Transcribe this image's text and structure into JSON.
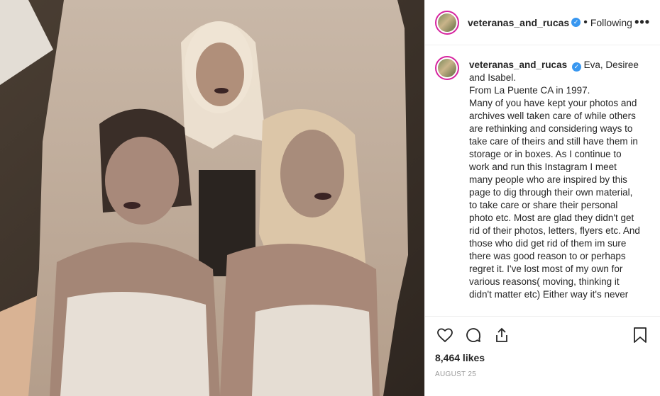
{
  "post": {
    "username": "veteranas_and_rucas",
    "follow_label": "Following",
    "separator": "•",
    "more_label": "•••",
    "verified_glyph": "✓"
  },
  "caption": {
    "username": "veteranas_and_rucas",
    "text": "Eva, Desiree\nand Isabel.\nFrom La Puente CA in 1997.\nMany of you have kept your photos and archives well taken care of while others are rethinking and considering ways to take care of theirs and still have them in storage or in boxes. As I continue to work and run this Instagram I meet many people who are inspired by this page to dig through their own material, to take care or share their personal photo etc. Most are glad they didn't get rid of their photos, letters, flyers etc. And those who did get rid of them im sure there was good reason to or perhaps regret it. I've lost most of my own for various reasons( moving, thinking it didn't matter etc) Either way it's never"
  },
  "engagement": {
    "likes": "8,464 likes",
    "date": "AUGUST 25"
  },
  "icons": {
    "like": "heart-icon",
    "comment": "comment-icon",
    "share": "share-icon",
    "save": "bookmark-icon",
    "verified": "verified-badge-icon"
  },
  "colors": {
    "verified": "#3897f0",
    "text": "#262626",
    "muted": "#999999",
    "divider": "#efefef"
  }
}
